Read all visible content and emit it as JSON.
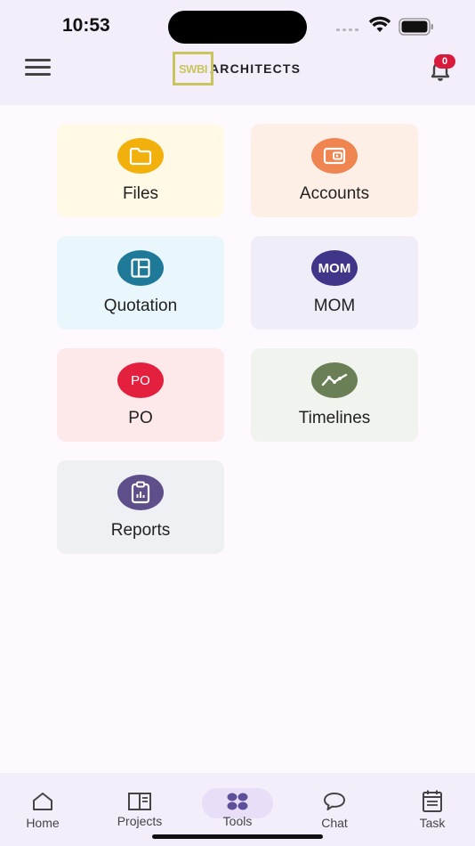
{
  "status_bar": {
    "time": "10:53"
  },
  "header": {
    "logo_box_text": "SWBI",
    "logo_text": "ARCHITECTS",
    "notification_count": "0"
  },
  "colors": {
    "files_bg": "#fff9e6",
    "files_icon": "#f2b00c",
    "accounts_bg": "#feefe6",
    "accounts_icon": "#ef8652",
    "quotation_bg": "#e9f6fb",
    "quotation_icon": "#1f7a99",
    "mom_bg": "#efeef8",
    "mom_icon": "#3f3589",
    "po_bg": "#fde8ea",
    "po_icon": "#e3203d",
    "timelines_bg": "#f1f3ee",
    "timelines_icon": "#6a7f55",
    "reports_bg": "#eff0f4",
    "reports_icon": "#5e4f8a"
  },
  "tools": [
    {
      "label": "Files",
      "icon": "folder-icon"
    },
    {
      "label": "Accounts",
      "icon": "wallet-icon"
    },
    {
      "label": "Quotation",
      "icon": "layout-icon",
      "text": ""
    },
    {
      "label": "MOM",
      "icon_text": "MOM"
    },
    {
      "label": "PO",
      "icon_text": "PO"
    },
    {
      "label": "Timelines",
      "icon": "trend-line-icon"
    },
    {
      "label": "Reports",
      "icon": "clipboard-chart-icon"
    }
  ],
  "bottom_nav": [
    {
      "label": "Home",
      "icon": "home-icon"
    },
    {
      "label": "Projects",
      "icon": "book-icon"
    },
    {
      "label": "Tools",
      "icon": "tools-dots-icon",
      "active": true
    },
    {
      "label": "Chat",
      "icon": "chat-bubble-icon"
    },
    {
      "label": "Task",
      "icon": "calendar-list-icon"
    }
  ]
}
